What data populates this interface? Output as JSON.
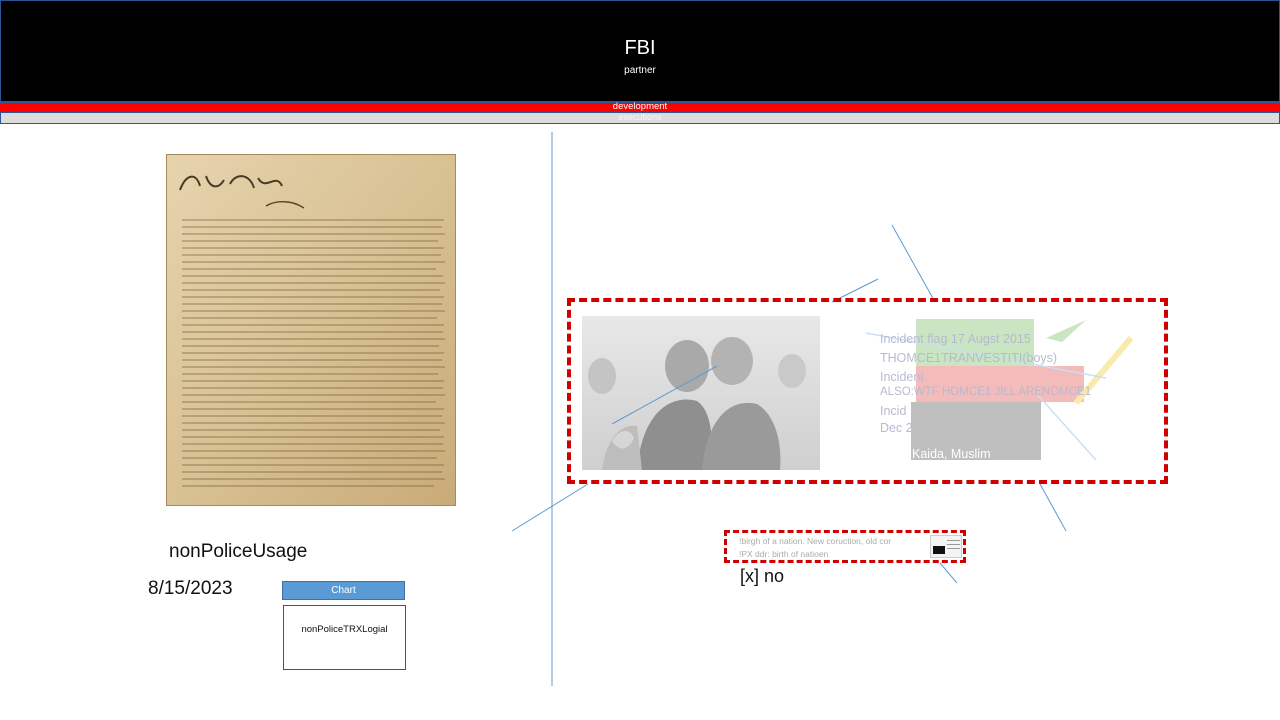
{
  "header": {
    "title": "FBI",
    "subtitle": "partner",
    "red_band_label": "development",
    "gray_band_label": "executions"
  },
  "left_panel": {
    "document_image": "constitution-document-image",
    "usage_label": "nonPoliceUsage",
    "date": "8/15/2023",
    "chart_button_label": "Chart",
    "chart_box_label": "nonPoliceTRXLogial"
  },
  "main_frame": {
    "photo": "grayscale-photo-two-men",
    "faded_lines": [
      "Incident flag 17 Augst 2015",
      "THOMCE1TRANVESTITI(boys)",
      "Incident",
      "ALSO:WTF HOMCE1 JILL ARENOMCE1",
      "Incid",
      "Dec 2",
      "Kaida, Muslim"
    ],
    "colors": {
      "frame_border": "#d00000",
      "green_block": "#59b045",
      "red_block": "#e03030",
      "dark_block": "#3a3a3a",
      "yellow_stripe": "#f2c000",
      "accent_line": "#5b9bd5"
    }
  },
  "small_frame": {
    "line1": "!birgh of a nation. New coruction, old cor",
    "line2": "!PX ddr: birth of natioen",
    "thumbnail": "small-screenshot-thumbnail"
  },
  "checkbox_label": "[x] no",
  "accent_color": "#5b9bd5",
  "header_color": "#000000",
  "band_color": "#ff0000"
}
